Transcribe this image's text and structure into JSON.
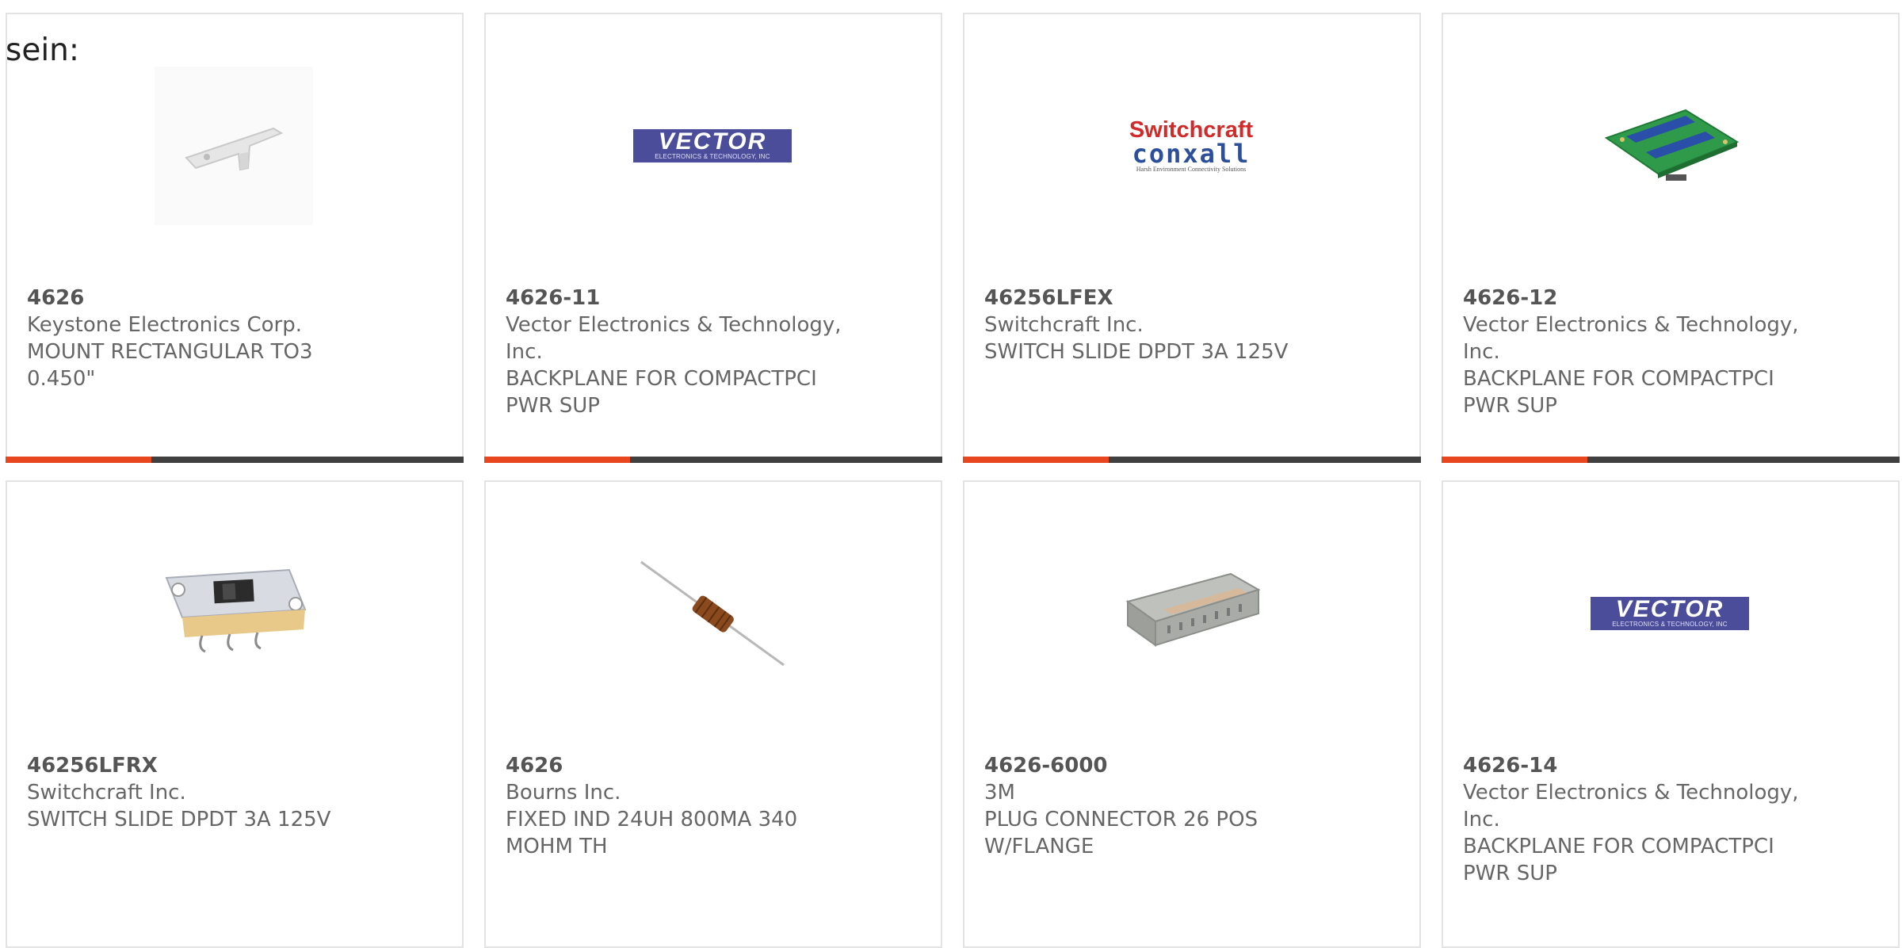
{
  "intro_text": "sein:",
  "products": [
    {
      "part": "4626",
      "manufacturer": "Keystone Electronics Corp.",
      "description": "MOUNT RECTANGULAR TO3 0.450\"",
      "image": "mount-bracket-image"
    },
    {
      "part": "4626-11",
      "manufacturer": "Vector Electronics & Technology, Inc.",
      "description": "BACKPLANE FOR COMPACTPCI PWR SUP",
      "image": "vector-logo",
      "logo_text": "VECTOR",
      "logo_subtext": "ELECTRONICS & TECHNOLOGY, INC"
    },
    {
      "part": "46256LFEX",
      "manufacturer": "Switchcraft Inc.",
      "description": "SWITCH SLIDE DPDT 3A 125V",
      "image": "switchcraft-logo",
      "logo_text": "Switchcraft",
      "logo_subtext": "conxall",
      "logo_tagline": "Harsh Environment Connectivity Solutions"
    },
    {
      "part": "4626-12",
      "manufacturer": "Vector Electronics & Technology, Inc.",
      "description": "BACKPLANE FOR COMPACTPCI PWR SUP",
      "image": "backplane-board-image"
    },
    {
      "part": "46256LFRX",
      "manufacturer": "Switchcraft Inc.",
      "description": "SWITCH SLIDE DPDT 3A 125V",
      "image": "slide-switch-image"
    },
    {
      "part": "4626",
      "manufacturer": "Bourns Inc.",
      "description": "FIXED IND 24UH 800MA 340 MOHM TH",
      "image": "inductor-image"
    },
    {
      "part": "4626-6000",
      "manufacturer": "3M",
      "description": "PLUG CONNECTOR 26 POS W/FLANGE",
      "image": "connector-image"
    },
    {
      "part": "4626-14",
      "manufacturer": "Vector Electronics & Technology, Inc.",
      "description": "BACKPLANE FOR COMPACTPCI PWR SUP",
      "image": "vector-logo",
      "logo_text": "VECTOR",
      "logo_subtext": "ELECTRONICS & TECHNOLOGY, INC"
    }
  ],
  "colors": {
    "accent": "#e8461f",
    "bar": "#404040",
    "border": "#e3e3e3",
    "text": "#666666",
    "vector_blue": "#4b4d9a",
    "switchcraft_red": "#d12a2a",
    "conxall_blue": "#2c4f9c"
  }
}
